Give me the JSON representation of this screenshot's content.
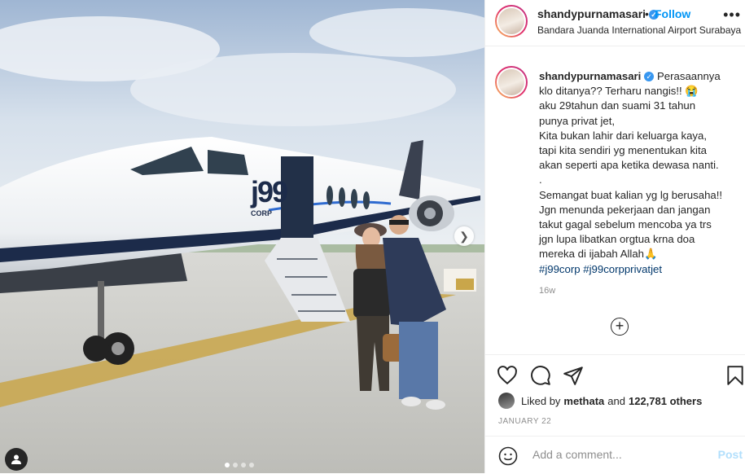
{
  "header": {
    "username": "shandypurnamasari",
    "separator": "•",
    "follow_label": "Follow",
    "location": "Bandara Juanda International Airport Surabaya",
    "more_icon": "more-horizontal-icon"
  },
  "caption": {
    "username": "shandypurnamasari",
    "lines": [
      "Perasaannya",
      "klo ditanya?? Terharu nangis!! 😭",
      "aku 29tahun dan suami 31 tahun",
      "punya privat jet,",
      "Kita bukan lahir dari keluarga kaya,",
      "tapi kita sendiri yg menentukan kita",
      "akan seperti apa ketika dewasa nanti.",
      ".",
      "Semangat buat kalian yg lg berusaha!!",
      "Jgn menunda pekerjaan dan jangan",
      "takut gagal sebelum mencoba ya trs",
      "jgn lupa libatkan orgtua krna doa",
      "mereka di ijabah Allah🙏"
    ],
    "hashtags": [
      "#j99corp",
      "#j99corpprivatjet"
    ],
    "age": "16w"
  },
  "photo": {
    "jet_logo_text": "j99",
    "jet_logo_sub": "CORP",
    "carousel_count": 4,
    "carousel_active": 0
  },
  "likes": {
    "prefix": "Liked by",
    "user": "methata",
    "conjunction": "and",
    "count": "122,781 others"
  },
  "date": "JANUARY 22",
  "comment": {
    "placeholder": "Add a comment...",
    "post_label": "Post"
  },
  "colors": {
    "link": "#0095f6",
    "hashtag": "#00376b",
    "muted": "#8e8e8e",
    "post_disabled": "#b2dffc"
  }
}
